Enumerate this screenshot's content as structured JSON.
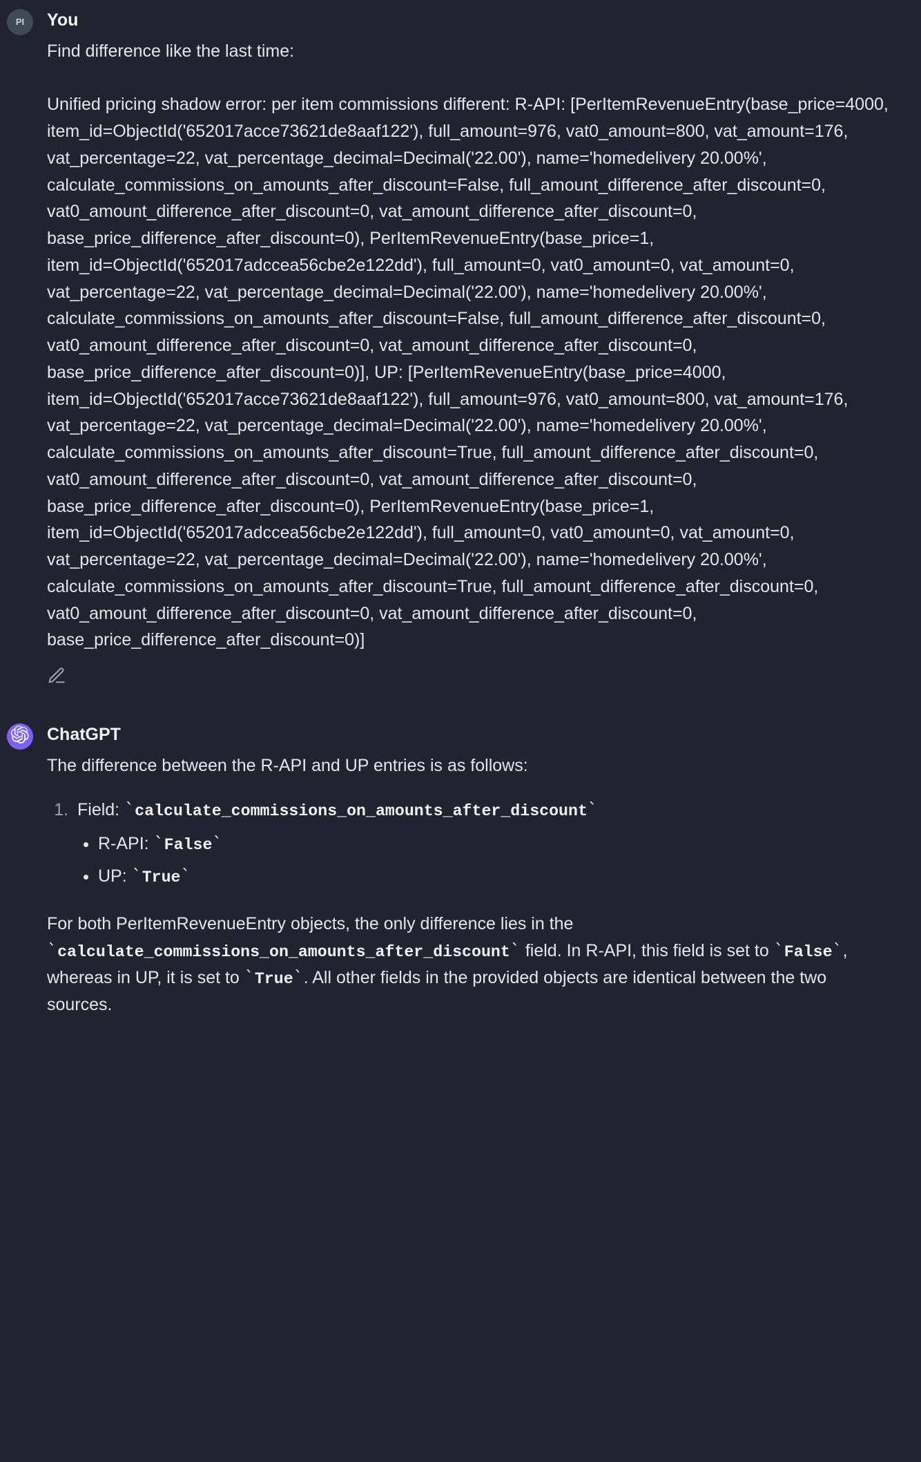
{
  "user": {
    "avatar_initials": "PI",
    "author": "You",
    "message": "Find difference like the last time:\n\nUnified pricing shadow error: per item commissions different: R-API: [PerItemRevenueEntry(base_price=4000, item_id=ObjectId('652017acce73621de8aaf122'), full_amount=976, vat0_amount=800, vat_amount=176, vat_percentage=22, vat_percentage_decimal=Decimal('22.00'), name='homedelivery 20.00%', calculate_commissions_on_amounts_after_discount=False, full_amount_difference_after_discount=0, vat0_amount_difference_after_discount=0, vat_amount_difference_after_discount=0, base_price_difference_after_discount=0), PerItemRevenueEntry(base_price=1, item_id=ObjectId('652017adccea56cbe2e122dd'), full_amount=0, vat0_amount=0, vat_amount=0, vat_percentage=22, vat_percentage_decimal=Decimal('22.00'), name='homedelivery 20.00%', calculate_commissions_on_amounts_after_discount=False, full_amount_difference_after_discount=0, vat0_amount_difference_after_discount=0, vat_amount_difference_after_discount=0, base_price_difference_after_discount=0)], UP: [PerItemRevenueEntry(base_price=4000, item_id=ObjectId('652017acce73621de8aaf122'), full_amount=976, vat0_amount=800, vat_amount=176, vat_percentage=22, vat_percentage_decimal=Decimal('22.00'), name='homedelivery 20.00%', calculate_commissions_on_amounts_after_discount=True, full_amount_difference_after_discount=0, vat0_amount_difference_after_discount=0, vat_amount_difference_after_discount=0, base_price_difference_after_discount=0), PerItemRevenueEntry(base_price=1, item_id=ObjectId('652017adccea56cbe2e122dd'), full_amount=0, vat0_amount=0, vat_amount=0, vat_percentage=22, vat_percentage_decimal=Decimal('22.00'), name='homedelivery 20.00%', calculate_commissions_on_amounts_after_discount=True, full_amount_difference_after_discount=0, vat0_amount_difference_after_discount=0, vat_amount_difference_after_discount=0, base_price_difference_after_discount=0)]"
  },
  "assistant": {
    "author": "ChatGPT",
    "intro": "The difference between the R-API and UP entries is as follows:",
    "list_item_field_label": "Field: ",
    "list_item_field_code": "calculate_commissions_on_amounts_after_discount",
    "sub_rapi_label": "R-API: ",
    "sub_rapi_code": "False",
    "sub_up_label": "UP: ",
    "sub_up_code": "True",
    "closing_pre1": "For both PerItemRevenueEntry objects, the only difference lies in the ",
    "closing_code1": "calculate_commissions_on_amounts_after_discount",
    "closing_mid1": " field. In R-API, this field is set to ",
    "closing_code2": "False",
    "closing_mid2": ", whereas in UP, it is set to ",
    "closing_code3": "True",
    "closing_post": ". All other fields in the provided objects are identical between the two sources."
  }
}
